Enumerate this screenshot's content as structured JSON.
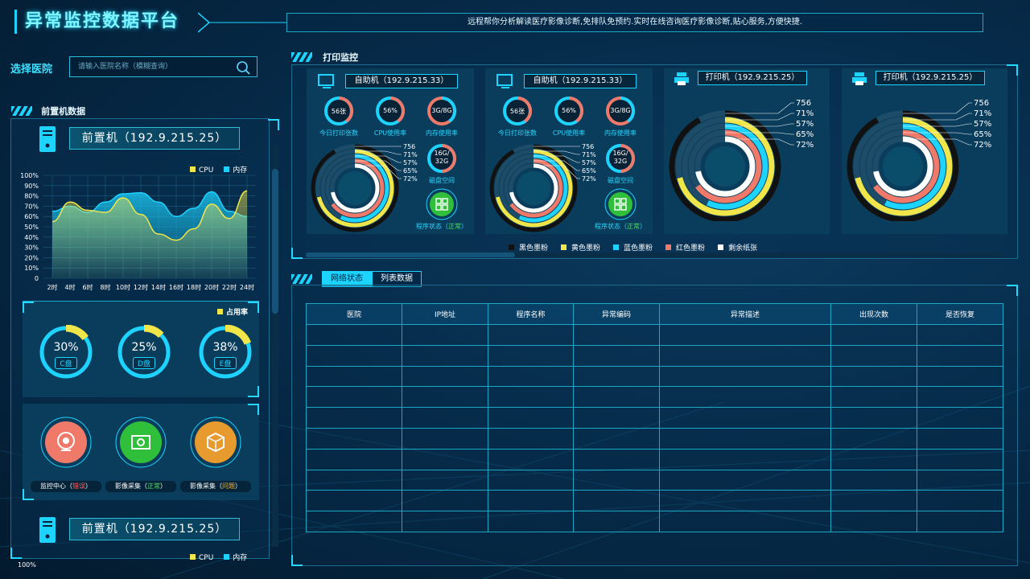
{
  "header": {
    "title": "异常监控数据平台",
    "banner": "远程帮你分析解读医疗影像诊断,免排队免预约.实时在线咨询医疗影像诊断,贴心服务,方便快捷."
  },
  "sidebar": {
    "select_label": "选择医院",
    "search_placeholder": "请输入医院名称（模糊查询）",
    "section_title": "前置机数据",
    "front1_name": "前置机（192.9.215.25）",
    "front2_name": "前置机（192.9.215.25）",
    "legend_cpu": "CPU",
    "legend_mem": "内存",
    "y_ticks": [
      "100%",
      "90%",
      "80%",
      "70%",
      "60%",
      "50%",
      "40%",
      "30%",
      "20%",
      "10%",
      "0"
    ],
    "x_ticks": [
      "2时",
      "4时",
      "6时",
      "8时",
      "10时",
      "12时",
      "14时",
      "16时",
      "18时",
      "20时",
      "22时",
      "24时"
    ],
    "bottom_y_top": "100%",
    "disk_legend": "占用率",
    "disks": [
      {
        "pct": "30%",
        "label": "C盘",
        "value": 0.3
      },
      {
        "pct": "25%",
        "label": "D盘",
        "value": 0.25
      },
      {
        "pct": "38%",
        "label": "E盘",
        "value": 0.38
      }
    ],
    "services": [
      {
        "name": "监控中心",
        "status": "错误",
        "status_color": "#ff5a5a",
        "color": "#f07a6a",
        "icon": "camera-icon"
      },
      {
        "name": "影像采集",
        "status": "正常",
        "status_color": "#47e05a",
        "color": "#2fbf3a",
        "icon": "photo-icon"
      },
      {
        "name": "影像采集",
        "status": "问题",
        "status_color": "#f0b23a",
        "color": "#e79a2e",
        "icon": "box-icon"
      }
    ]
  },
  "chart_data": {
    "type": "area",
    "categories": [
      "2时",
      "4时",
      "6时",
      "8时",
      "10时",
      "12时",
      "14时",
      "16时",
      "18时",
      "20时",
      "22时",
      "24时"
    ],
    "series": [
      {
        "name": "CPU",
        "color": "#f0e64a",
        "values": [
          55,
          74,
          66,
          64,
          78,
          62,
          43,
          37,
          48,
          72,
          58,
          85
        ]
      },
      {
        "name": "内存",
        "color": "#1dd3ff",
        "values": [
          65,
          70,
          64,
          74,
          82,
          83,
          74,
          60,
          68,
          84,
          65,
          60
        ]
      }
    ],
    "ylim": [
      0,
      100
    ],
    "grid": true,
    "legend": "top-right"
  },
  "print": {
    "section_title": "打印监控",
    "kiosks": [
      {
        "name": "自助机（192.9.215.33）",
        "today": "56张",
        "today_label": "今日打印张数",
        "cpu": "56%",
        "cpu_label": "CPU使用率",
        "mem": "3G/8G",
        "mem_label": "内存使用率",
        "disk": "16G/32G",
        "disk_label": "磁盘空间",
        "status_label": "程序状态",
        "status": "正常",
        "rings": [
          "756",
          "71%",
          "57%",
          "65%",
          "72%"
        ]
      },
      {
        "name": "自助机（192.9.215.33）",
        "today": "56张",
        "today_label": "今日打印张数",
        "cpu": "56%",
        "cpu_label": "CPU使用率",
        "mem": "3G/8G",
        "mem_label": "内存使用率",
        "disk": "16G/32G",
        "disk_label": "磁盘空间",
        "status_label": "程序状态",
        "status": "正常",
        "rings": [
          "756",
          "71%",
          "57%",
          "65%",
          "72%"
        ]
      }
    ],
    "printers": [
      {
        "name": "打印机（192.9.215.25）",
        "rings": [
          "756",
          "71%",
          "57%",
          "65%",
          "72%"
        ]
      },
      {
        "name": "打印机（192.9.215.25）",
        "rings": [
          "756",
          "71%",
          "57%",
          "65%",
          "72%"
        ]
      }
    ],
    "legend": [
      {
        "label": "黑色墨粉",
        "color": "#111111"
      },
      {
        "label": "黄色墨粉",
        "color": "#f0e64a"
      },
      {
        "label": "蓝色墨粉",
        "color": "#1dd3ff"
      },
      {
        "label": "红色墨粉",
        "color": "#f07a6a"
      },
      {
        "label": "剩余纸张",
        "color": "#ffffff"
      }
    ]
  },
  "table": {
    "tabs": [
      "网络状态",
      "列表数据"
    ],
    "columns": [
      "医院",
      "IP地址",
      "程序名称",
      "异常编码",
      "异常描述",
      "出现次数",
      "是否恢复"
    ]
  }
}
